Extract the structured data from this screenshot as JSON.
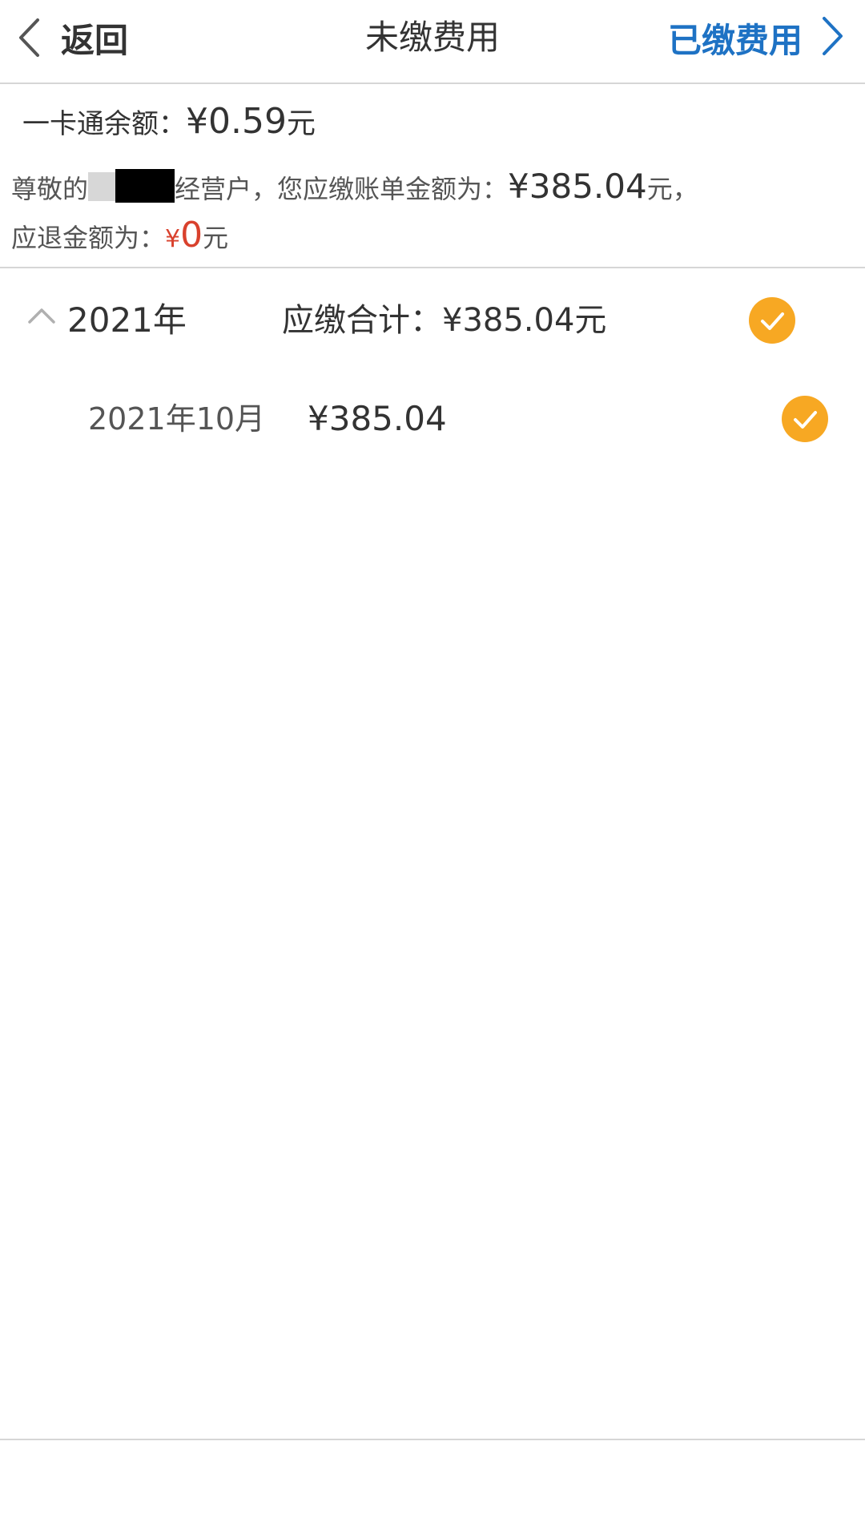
{
  "header": {
    "back_label": "返回",
    "title": "未缴费用",
    "paid_link_label": "已缴费用"
  },
  "info": {
    "balance_label": "一卡通余额：",
    "balance_value": "¥0.59",
    "balance_unit": "元",
    "notice_prefix": "尊敬的",
    "notice_middle": "经营户，您应缴账单金额为：",
    "bill_value": "¥385.04",
    "bill_unit": "元，",
    "refund_label": "应退金额为：",
    "refund_currency": "¥",
    "refund_value": "0",
    "refund_unit": "元"
  },
  "bills": {
    "year_label": "2021年",
    "year_total_label": "应缴合计：¥385.04元",
    "year_selected": true,
    "months": [
      {
        "label": "2021年10月",
        "amount": "¥385.04",
        "selected": true
      }
    ]
  },
  "icons": {
    "back": "chevron-left-icon",
    "paid": "chevron-right-icon",
    "collapse": "chevron-up-icon",
    "check": "check-circle-icon"
  },
  "colors": {
    "accent_blue": "#1e72c4",
    "check_orange": "#f7a823",
    "refund_red": "#d9412d"
  }
}
